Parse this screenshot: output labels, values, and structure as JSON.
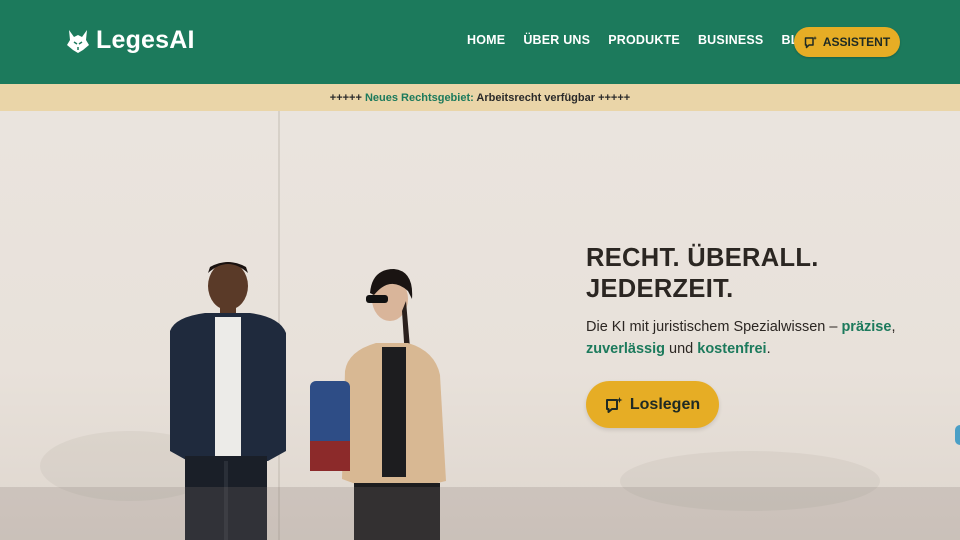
{
  "brand": {
    "name": "LegesAI",
    "logo_icon": "lynx-head-icon"
  },
  "nav": {
    "items": [
      {
        "label": "HOME"
      },
      {
        "label": "ÜBER UNS"
      },
      {
        "label": "PRODUKTE"
      },
      {
        "label": "BUSINESS"
      },
      {
        "label": "BLOG"
      }
    ],
    "assistant_button": {
      "label": "ASSISTENT",
      "icon": "chat-sparkle-icon"
    }
  },
  "announcement": {
    "prefix": "+++++ ",
    "highlight": "Neues Rechtsgebiet:",
    "rest": " Arbeitsrecht verfügbar +++++"
  },
  "hero": {
    "headline_line1": "RECHT. ÜBERALL.",
    "headline_line2": "JEDERZEIT.",
    "sub_part1": "Die KI mit juristischem Spezialwissen – ",
    "sub_hl1": "präzise",
    "sub_part2": ",",
    "sub_hl2": "zuverlässig",
    "sub_part3": " und ",
    "sub_hl3": "kostenfrei",
    "sub_part4": ".",
    "cta_label": "Loslegen",
    "cta_icon": "chat-sparkle-icon"
  },
  "colors": {
    "primary": "#1c7a5c",
    "accent": "#e6ad25",
    "announcement_bg": "#ead5a8",
    "text_dark": "#2b2622"
  }
}
